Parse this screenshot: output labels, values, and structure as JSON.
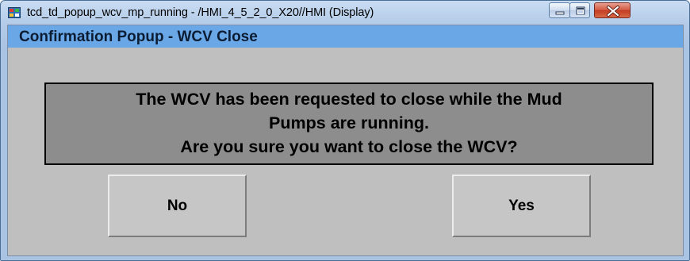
{
  "window": {
    "title": "tcd_td_popup_wcv_mp_running - /HMI_4_5_2_0_X20//HMI (Display)",
    "icon": "hmi-app-icon",
    "caption_buttons": [
      "minimize-icon",
      "maximize-icon",
      "close-icon"
    ]
  },
  "popup": {
    "header": "Confirmation Popup - WCV Close",
    "message": {
      "line1": "The WCV has been requested to close while the Mud",
      "line2": "Pumps are running.",
      "line3": "Are you sure you want to close the WCV?"
    },
    "buttons": {
      "no_label": "No",
      "yes_label": "Yes"
    }
  },
  "colors": {
    "header_bar": "#69a7e6",
    "panel_background": "#bfbfbf",
    "message_background": "#8d8d8d",
    "close_button": "#c33b22"
  }
}
